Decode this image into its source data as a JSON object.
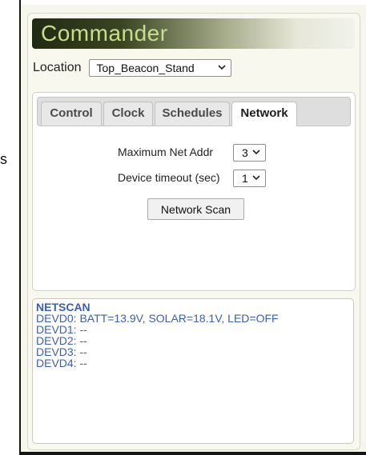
{
  "edge_text": "s",
  "app": {
    "title": "Commander"
  },
  "location": {
    "label": "Location",
    "selected": "Top_Beacon_Stand"
  },
  "tabs": [
    {
      "label": "Control",
      "active": false
    },
    {
      "label": "Clock",
      "active": false
    },
    {
      "label": "Schedules",
      "active": false
    },
    {
      "label": "Network",
      "active": true
    }
  ],
  "network": {
    "max_net_addr": {
      "label": "Maximum Net Addr",
      "value": "3"
    },
    "device_timeout": {
      "label": "Device timeout (sec)",
      "value": "1"
    },
    "scan_button": "Network Scan"
  },
  "log": {
    "lines": [
      "NETSCAN",
      "DEVD0: BATT=13.9V, SOLAR=18.1V, LED=OFF",
      "DEVD1: --",
      "DEVD2: --",
      "DEVD3: --",
      "DEVD4: --"
    ]
  },
  "colors": {
    "title_text": "#c7df8d",
    "log_text": "#3c5fa8",
    "header_dark": "#1f2a12"
  },
  "icons": {
    "select_arrow": "chevron-down-icon"
  }
}
